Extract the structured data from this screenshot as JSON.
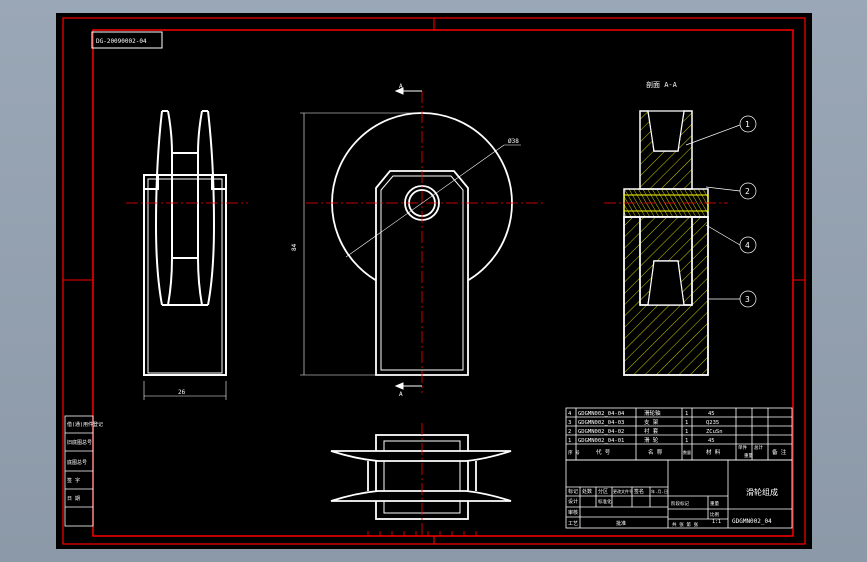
{
  "drawing": {
    "code_box": "DG-20090002-04",
    "section_label": "剖面 A-A",
    "cut_label": "A",
    "dim_diameter": "Ø38",
    "dim_height": "84",
    "dim_width": "26",
    "callouts": [
      "1",
      "2",
      "4",
      "3"
    ]
  },
  "revision_block": [
    "借(通)用件登记",
    "旧底图总号",
    "底图总号",
    "签 字",
    "日 期"
  ],
  "bom": {
    "rows": [
      {
        "no": "4",
        "code": "GDGMN002_04-04",
        "name": "滑轮轴",
        "qty": "1",
        "material": "45"
      },
      {
        "no": "3",
        "code": "GDGMN002_04-03",
        "name": "支 架",
        "qty": "1",
        "material": "Q235"
      },
      {
        "no": "2",
        "code": "GDGMN002_04-02",
        "name": "衬 套",
        "qty": "1",
        "material": "ZCuSn"
      },
      {
        "no": "1",
        "code": "GDGMN002_04-01",
        "name": "滑 轮",
        "qty": "1",
        "material": "45"
      }
    ],
    "header": {
      "no": "序 号",
      "code": "代 号",
      "name": "名 称",
      "qty": "数量",
      "material": "材 料",
      "unit_weight": "单件",
      "total_weight": "总计",
      "weight_label": "重量",
      "remark": "备 注"
    }
  },
  "title_block": {
    "title": "滑轮组成",
    "drawing_no": "GDGMN002_04",
    "scale": "1:1",
    "marks": [
      "标记",
      "处数",
      "分区",
      "更改文件号",
      "签名",
      "年.月.日"
    ],
    "roles": [
      "设计",
      "审核",
      "工艺",
      "标准化",
      "批准"
    ],
    "stage": "阶段标记",
    "weight": "重量",
    "ratio": "比例",
    "sheets": "共 张 第 张"
  },
  "colors": {
    "border": "#ff0000",
    "lines": "#ffffff",
    "hatch": "#ffff00",
    "centerline": "#ff0000",
    "background": "#000000"
  }
}
